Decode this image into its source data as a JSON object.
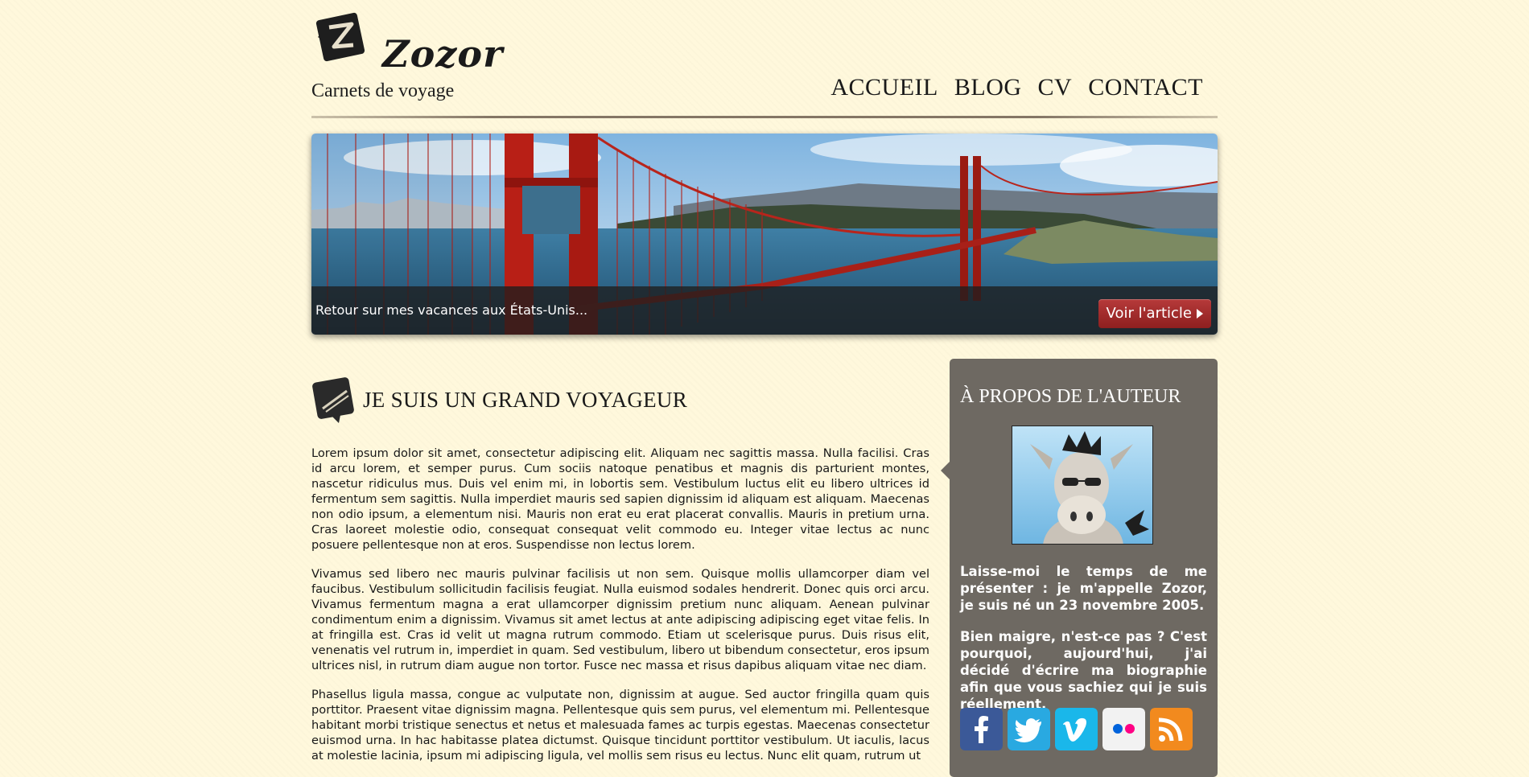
{
  "header": {
    "logo_name": "Zozor",
    "tagline": "Carnets de voyage",
    "nav": [
      "ACCUEIL",
      "BLOG",
      "CV",
      "CONTACT"
    ]
  },
  "banner": {
    "caption": "Retour sur mes vacances aux États-Unis...",
    "button_label": "Voir l'article"
  },
  "article": {
    "title": "JE SUIS UN GRAND VOYAGEUR",
    "paragraphs": [
      "Lorem ipsum dolor sit amet, consectetur adipiscing elit. Aliquam nec sagittis massa. Nulla facilisi. Cras id arcu lorem, et semper purus. Cum sociis natoque penatibus et magnis dis parturient montes, nascetur ridiculus mus. Duis vel enim mi, in lobortis sem. Vestibulum luctus elit eu libero ultrices id fermentum sem sagittis. Nulla imperdiet mauris sed sapien dignissim id aliquam est aliquam. Maecenas non odio ipsum, a elementum nisi. Mauris non erat eu erat placerat convallis. Mauris in pretium urna. Cras laoreet molestie odio, consequat consequat velit commodo eu. Integer vitae lectus ac nunc posuere pellentesque non at eros. Suspendisse non lectus lorem.",
      "Vivamus sed libero nec mauris pulvinar facilisis ut non sem. Quisque mollis ullamcorper diam vel faucibus. Vestibulum sollicitudin facilisis feugiat. Nulla euismod sodales hendrerit. Donec quis orci arcu. Vivamus fermentum magna a erat ullamcorper dignissim pretium nunc aliquam. Aenean pulvinar condimentum enim a dignissim. Vivamus sit amet lectus at ante adipiscing adipiscing eget vitae felis. In at fringilla est. Cras id velit ut magna rutrum commodo. Etiam ut scelerisque purus. Duis risus elit, venenatis vel rutrum in, imperdiet in quam. Sed vestibulum, libero ut bibendum consectetur, eros ipsum ultrices nisl, in rutrum diam augue non tortor. Fusce nec massa et risus dapibus aliquam vitae nec diam.",
      "Phasellus ligula massa, congue ac vulputate non, dignissim at augue. Sed auctor fringilla quam quis porttitor. Praesent vitae dignissim magna. Pellentesque quis sem purus, vel elementum mi. Pellentesque habitant morbi tristique senectus et netus et malesuada fames ac turpis egestas. Maecenas consectetur euismod urna. In hac habitasse platea dictumst. Quisque tincidunt porttitor vestibulum. Ut iaculis, lacus at molestie lacinia, ipsum mi adipiscing ligula, vel mollis sem risus eu lectus. Nunc elit quam, rutrum ut"
    ]
  },
  "aside": {
    "title": "À PROPOS DE L'AUTEUR",
    "paragraphs": [
      "Laisse-moi le temps de me présenter : je m'appelle Zozor, je suis né un 23 novembre 2005.",
      "Bien maigre, n'est-ce pas ? C'est pourquoi, aujourd'hui, j'ai décidé d'écrire ma biographie afin que vous sachiez qui je suis réellement."
    ],
    "socials": [
      "facebook-icon",
      "twitter-icon",
      "vimeo-icon",
      "flickr-icon",
      "rss-icon"
    ]
  },
  "colors": {
    "page_bg": "#fff8dc",
    "aside_bg": "#6e6962",
    "button_red": "#a02a2a",
    "facebook": "#3b5998",
    "twitter": "#29a9e1",
    "vimeo": "#1ab7ea",
    "flickr": "#f2f2f2",
    "rss": "#f28a1e"
  }
}
